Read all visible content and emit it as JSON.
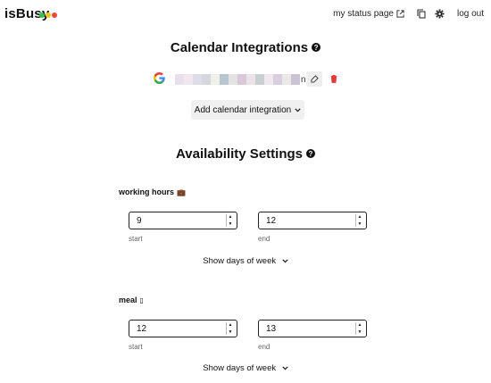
{
  "app": {
    "logo": "isBusy",
    "dot_colors": [
      "#33c24d",
      "#f0c419",
      "#e84a3c"
    ]
  },
  "nav": {
    "status_page": "my status page",
    "logout": "log out",
    "icons": [
      "external-link-icon",
      "copy-icon",
      "gear-icon"
    ]
  },
  "calendar": {
    "title": "Calendar Integrations",
    "help": "?",
    "account": {
      "provider": "G",
      "provider_icon": "google-icon",
      "visible_tail": "n"
    },
    "add_button": "Add calendar integration"
  },
  "availability": {
    "title": "Availability Settings",
    "help": "?",
    "groups": [
      {
        "label": "working hours",
        "emoji": "💼",
        "start": "9",
        "end": "12",
        "start_label": "start",
        "end_label": "end",
        "days_toggle": "Show days of week"
      },
      {
        "label": "meal",
        "emoji": "▯",
        "start": "12",
        "end": "13",
        "start_label": "start",
        "end_label": "end",
        "days_toggle": "Show days of week"
      }
    ]
  },
  "colors": {
    "delete": "#e23b3b",
    "button_bg": "#f0f0f0"
  }
}
